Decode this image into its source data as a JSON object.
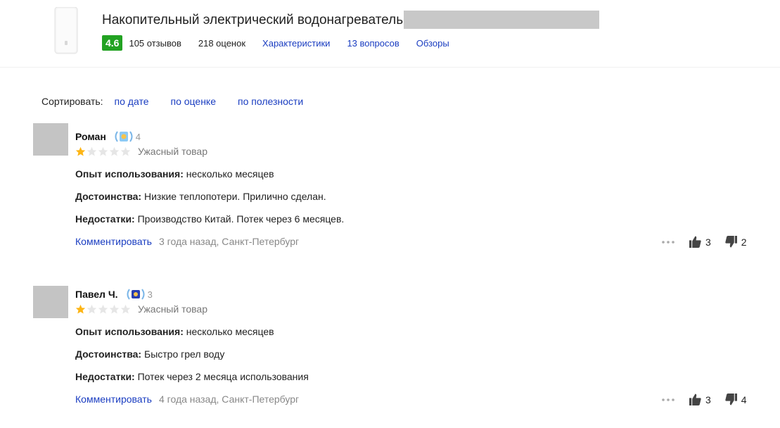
{
  "header": {
    "title": "Накопительный электрический водонагреватель",
    "rating": "4.6",
    "reviews_count": "105 отзывов",
    "ratings_count": "218 оценок",
    "links": [
      "Характеристики",
      "13 вопросов",
      "Обзоры"
    ]
  },
  "sort": {
    "label": "Сортировать:",
    "options": [
      "по дате",
      "по оценке",
      "по полезности"
    ]
  },
  "reviews": [
    {
      "author": "Роман",
      "level": "4",
      "badge_icon": "laurel-badge-icon",
      "stars": 1,
      "stars_max": 5,
      "verdict": "Ужасный товар",
      "experience_label": "Опыт использования:",
      "experience": "несколько месяцев",
      "pros_label": "Достоинства:",
      "pros": "Низкие теплопотери. Прилично сделан.",
      "cons_label": "Недостатки:",
      "cons": "Производство Китай. Потек через 6 месяцев.",
      "comment_label": "Комментировать",
      "date_city": "3 года назад, Санкт-Петербург",
      "likes": "3",
      "dislikes": "2"
    },
    {
      "author": "Павел Ч.",
      "level": "3",
      "badge_icon": "laurel-badge-icon",
      "stars": 1,
      "stars_max": 5,
      "verdict": "Ужасный товар",
      "experience_label": "Опыт использования:",
      "experience": "несколько месяцев",
      "pros_label": "Достоинства:",
      "pros": "Быстро грел воду",
      "cons_label": "Недостатки:",
      "cons": "Потек через 2 месяца использования",
      "comment_label": "Комментировать",
      "date_city": "4 года назад, Санкт-Петербург",
      "likes": "3",
      "dislikes": "4"
    }
  ],
  "colors": {
    "link": "#1a3dc1",
    "rating_badge": "#22a222",
    "star_filled": "#fdb515",
    "star_empty": "#e6e6e6"
  }
}
